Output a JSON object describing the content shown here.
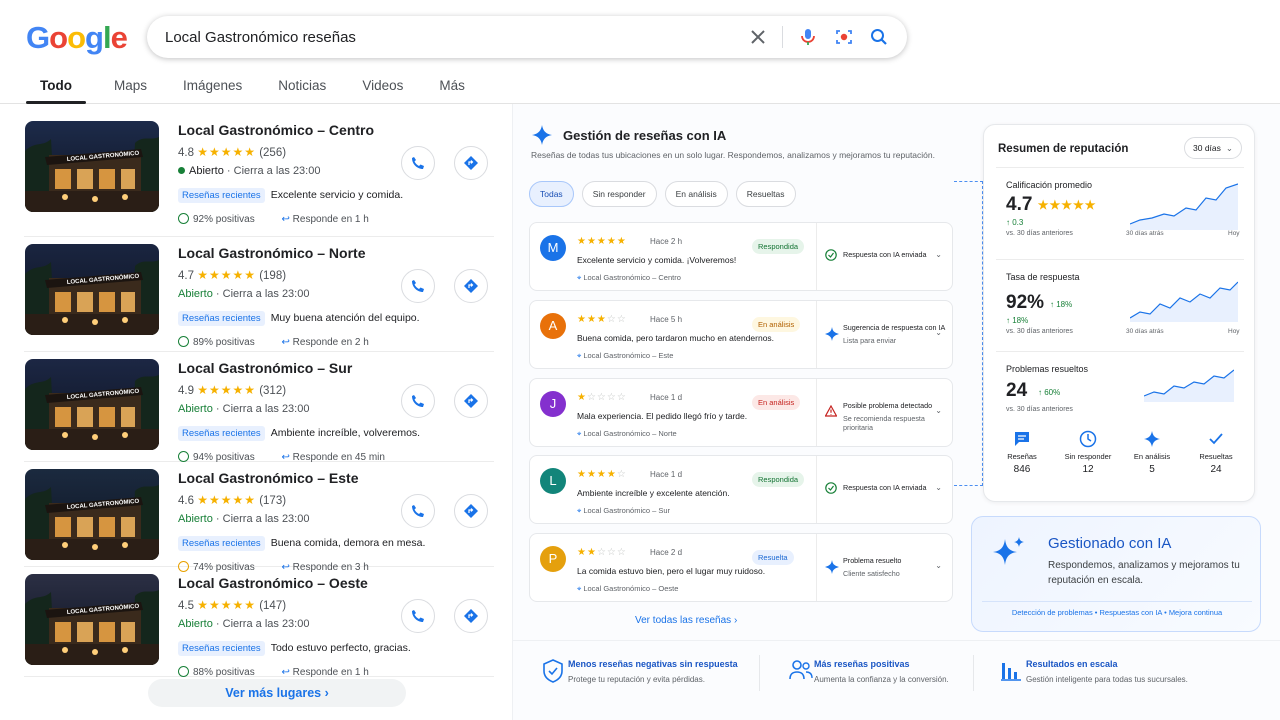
{
  "search": {
    "query": "Local Gastronómico reseñas"
  },
  "tabs": [
    "Todo",
    "Maps",
    "Imágenes",
    "Noticias",
    "Videos",
    "Más"
  ],
  "places": [
    {
      "name": "Local Gastronómico – Centro",
      "rating": "4.8",
      "stars": "★★★★★",
      "count": "(256)",
      "status": "Abierto",
      "closes": "Cierra a las 23:00",
      "chip": "Reseñas recientes",
      "review": "Excelente servicio y comida.",
      "positive": "92% positivas",
      "responds": "Responde en 1 h",
      "sentiment": "good"
    },
    {
      "name": "Local Gastronómico – Norte",
      "rating": "4.7",
      "stars": "★★★★★",
      "count": "(198)",
      "status": "Abierto",
      "closes": "Cierra a las 23:00",
      "chip": "Reseñas recientes",
      "review": "Muy buena atención del equipo.",
      "positive": "89% positivas",
      "responds": "Responde en 2 h",
      "sentiment": "good"
    },
    {
      "name": "Local Gastronómico – Sur",
      "rating": "4.9",
      "stars": "★★★★★",
      "count": "(312)",
      "status": "Abierto",
      "closes": "Cierra a las 23:00",
      "chip": "Reseñas recientes",
      "review": "Ambiente increíble, volveremos.",
      "positive": "94% positivas",
      "responds": "Responde en 45 min",
      "sentiment": "good"
    },
    {
      "name": "Local Gastronómico – Este",
      "rating": "4.6",
      "stars": "★★★★★",
      "count": "(173)",
      "status": "Abierto",
      "closes": "Cierra a las 23:00",
      "chip": "Reseñas recientes",
      "review": "Buena comida, demora en mesa.",
      "positive": "74% positivas",
      "responds": "Responde en 3 h",
      "sentiment": "mid"
    },
    {
      "name": "Local Gastronómico – Oeste",
      "rating": "4.5",
      "stars": "★★★★★",
      "count": "(147)",
      "status": "Abierto",
      "closes": "Cierra a las 23:00",
      "chip": "Reseñas recientes",
      "review": "Todo estuvo perfecto, gracias.",
      "positive": "88% positivas",
      "responds": "Responde en 1 h",
      "sentiment": "good"
    }
  ],
  "more_places": "Ver más lugares",
  "panel": {
    "title": "Gestión de reseñas con IA",
    "subtitle": "Reseñas de todas tus ubicaciones en un solo lugar. Respondemos, analizamos y mejoramos tu reputación.",
    "filters": [
      "Todas",
      "Sin responder",
      "En análisis",
      "Resueltas"
    ],
    "see_all": "Ver todas las reseñas"
  },
  "reviews": [
    {
      "initial": "M",
      "color": "#1a73e8",
      "stars": "★★★★★",
      "empty": "",
      "time": "Hace 2 h",
      "text": "Excelente servicio y comida. ¡Volveremos!",
      "location": "Local Gastronómico – Centro",
      "badge": "Respondida",
      "badge_type": "green",
      "action": "Respuesta con IA enviada",
      "action2": "",
      "action_icon": "check"
    },
    {
      "initial": "A",
      "color": "#e8710a",
      "stars": "★★★",
      "empty": "☆☆",
      "time": "Hace 5 h",
      "text": "Buena comida, pero tardaron mucho en atendernos.",
      "location": "Local Gastronómico – Este",
      "badge": "En análisis",
      "badge_type": "orange",
      "action": "Sugerencia de respuesta con IA",
      "action2": "Lista para enviar",
      "action_icon": "spark"
    },
    {
      "initial": "J",
      "color": "#8430ce",
      "stars": "★",
      "empty": "☆☆☆☆",
      "time": "Hace 1 d",
      "text": "Mala experiencia. El pedido llegó frío y tarde.",
      "location": "Local Gastronómico – Norte",
      "badge": "En análisis",
      "badge_type": "red",
      "action": "Posible problema detectado",
      "action2": "Se recomienda respuesta prioritaria",
      "action_icon": "warn"
    },
    {
      "initial": "L",
      "color": "#12857a",
      "stars": "★★★★",
      "empty": "☆",
      "time": "Hace 1 d",
      "text": "Ambiente increíble y excelente atención.",
      "location": "Local Gastronómico – Sur",
      "badge": "Respondida",
      "badge_type": "green",
      "action": "Respuesta con IA enviada",
      "action2": "",
      "action_icon": "check"
    },
    {
      "initial": "P",
      "color": "#e5a00d",
      "stars": "★★",
      "empty": "☆☆☆",
      "time": "Hace 2 d",
      "text": "La comida estuvo bien, pero el lugar muy ruidoso.",
      "location": "Local Gastronómico – Oeste",
      "badge": "Resuelta",
      "badge_type": "blue",
      "action": "Problema resuelto",
      "action2": "Cliente satisfecho",
      "action_icon": "spark"
    }
  ],
  "reputation": {
    "title": "Resumen de reputación",
    "period": "30 días",
    "metrics": [
      {
        "label": "Calificación promedio",
        "value": "4.7",
        "stars": "★★★★★",
        "delta": "0.3",
        "vs": "vs. 30 días anteriores",
        "axis_left": "30 días atrás",
        "axis_right": "Hoy"
      },
      {
        "label": "Tasa de respuesta",
        "value": "92%",
        "delta": "18%",
        "vs": "vs. 30 días anteriores",
        "axis_left": "30 días atrás",
        "axis_right": "Hoy"
      },
      {
        "label": "Problemas resueltos",
        "value": "24",
        "delta": "60%",
        "vs": "vs. 30 días anteriores"
      }
    ],
    "counts": [
      {
        "label": "Reseñas",
        "value": "846"
      },
      {
        "label": "Sin responder",
        "value": "12"
      },
      {
        "label": "En análisis",
        "value": "5"
      },
      {
        "label": "Resueltas",
        "value": "24"
      }
    ]
  },
  "ai_card": {
    "title": "Gestionado con IA",
    "description": "Respondemos, analizamos y mejoramos tu reputación en escala.",
    "features": "Detección de problemas  •  Respuestas con IA  •  Mejora continua"
  },
  "benefits": [
    {
      "title": "Menos reseñas negativas sin respuesta",
      "desc": "Protege tu reputación y evita pérdidas."
    },
    {
      "title": "Más reseñas positivas",
      "desc": "Aumenta la confianza y la conversión."
    },
    {
      "title": "Resultados en escala",
      "desc": "Gestión inteligente para todas tus sucursales."
    }
  ],
  "colors": {
    "brand": "#1a73e8",
    "star": "#f6b100",
    "positive": "#188038"
  }
}
